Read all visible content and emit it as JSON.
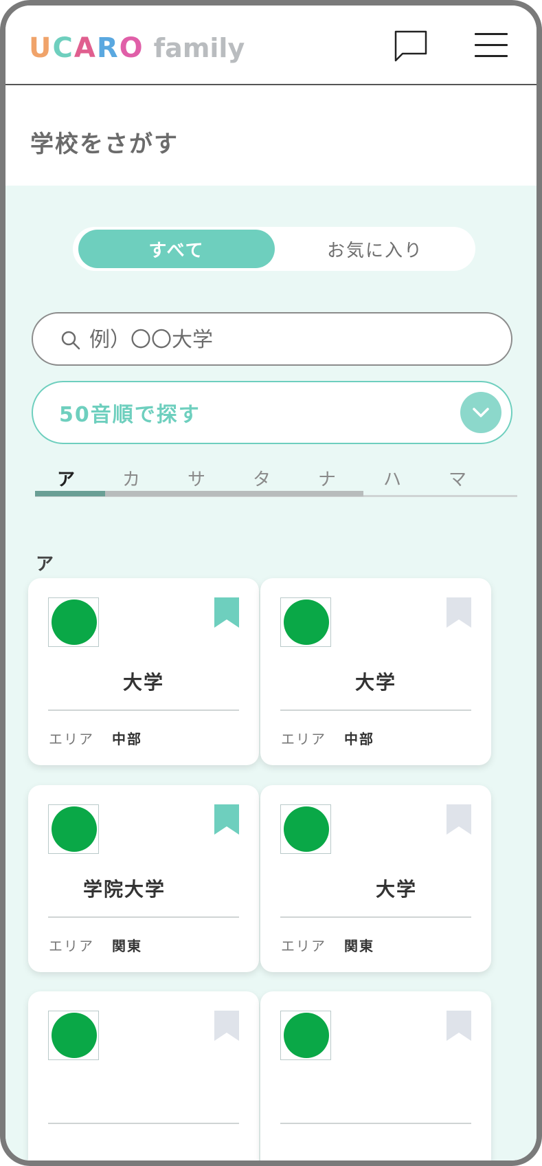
{
  "header": {
    "logo_letters": [
      "U",
      "C",
      "A",
      "R",
      "O"
    ],
    "logo_colors": [
      "#f0a36a",
      "#6ecfbe",
      "#e05f8f",
      "#5aa8e0",
      "#e05fa8"
    ],
    "logo_suffix": "family",
    "icons": [
      "chat-bubble-icon",
      "hamburger-menu-icon"
    ]
  },
  "page": {
    "title": "学校をさがす"
  },
  "filter": {
    "all_label": "すべて",
    "favorites_label": "お気に入り",
    "selected": "すべて"
  },
  "search": {
    "placeholder": "例）〇〇大学"
  },
  "kana_select": {
    "label": "50音順で探す"
  },
  "kana_tabs": [
    {
      "label": "ア",
      "active": true
    },
    {
      "label": "カ",
      "active": false
    },
    {
      "label": "サ",
      "active": false
    },
    {
      "label": "タ",
      "active": false
    },
    {
      "label": "ナ",
      "active": false
    },
    {
      "label": "ハ",
      "active": false
    },
    {
      "label": "マ",
      "active": false
    }
  ],
  "section": {
    "letter": "ア"
  },
  "area_label": "エリア",
  "colors": {
    "accent": "#6ecfbe",
    "bookmark_on": "#6ecfbe",
    "bookmark_off": "#dfe3ea",
    "logo_green": "#0aa847",
    "background": "#eaf8f5"
  },
  "schools": [
    {
      "name": "大学",
      "area": "中部",
      "bookmarked": true
    },
    {
      "name": "大学",
      "area": "中部",
      "bookmarked": false
    },
    {
      "name": "学院大学",
      "area": "関東",
      "bookmarked": true
    },
    {
      "name": "大学",
      "area": "関東",
      "bookmarked": false
    },
    {
      "name": "",
      "area": "",
      "bookmarked": false
    },
    {
      "name": "",
      "area": "",
      "bookmarked": false
    }
  ]
}
